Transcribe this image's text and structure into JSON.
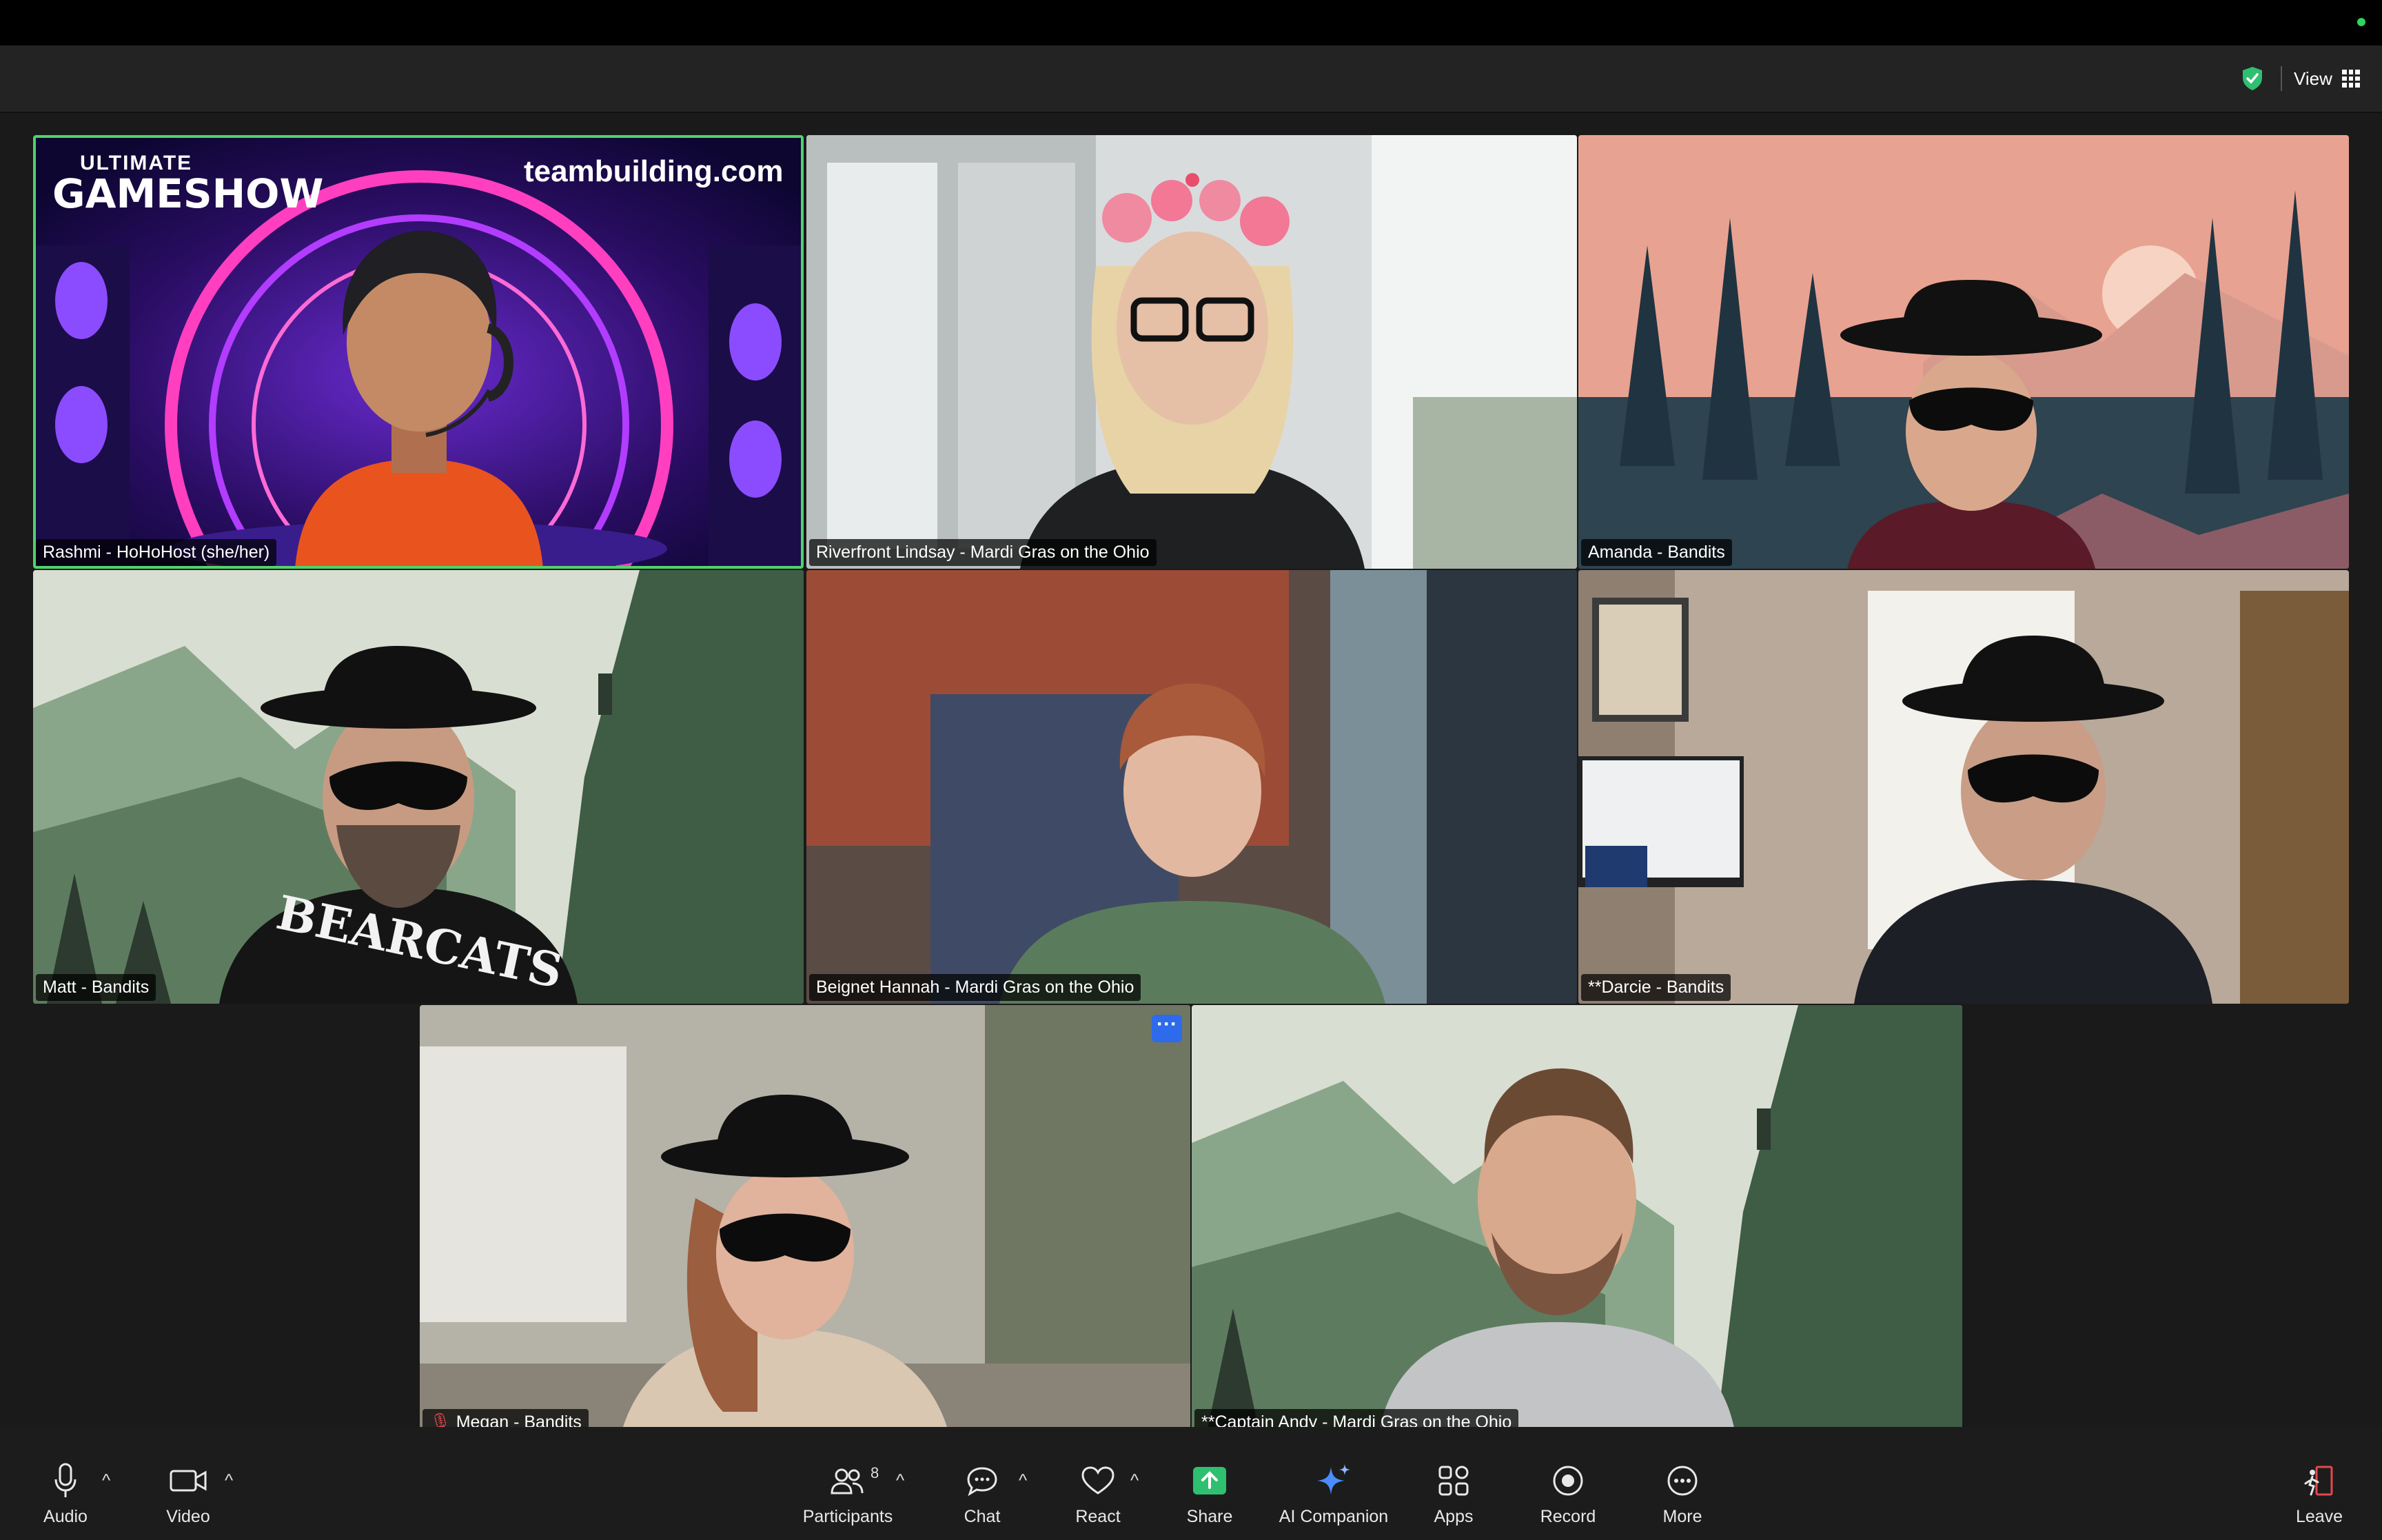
{
  "header": {
    "view_label": "View"
  },
  "participants": [
    {
      "name": "Rashmi - HoHoHost (she/her)",
      "active_speaker": true,
      "background_text": [
        "ULTIMATE",
        "GAMESHOW",
        "teambuilding.com"
      ]
    },
    {
      "name": "Riverfront Lindsay - Mardi Gras on the Ohio"
    },
    {
      "name": "Amanda - Bandits"
    },
    {
      "name": "Matt - Bandits",
      "shirt_text": "BEARCATS"
    },
    {
      "name": "Beignet Hannah - Mardi Gras on the Ohio"
    },
    {
      "name": "**Darcie - Bandits"
    },
    {
      "name": "Megan - Bandits",
      "muted": true
    },
    {
      "name": "**Captain Andy - Mardi Gras on the Ohio"
    }
  ],
  "tile_menu": "···",
  "toolbar": {
    "audio": "Audio",
    "video": "Video",
    "participants": "Participants",
    "participants_count": "8",
    "chat": "Chat",
    "react": "React",
    "share": "Share",
    "ai_companion": "AI Companion",
    "apps": "Apps",
    "record": "Record",
    "more": "More",
    "leave": "Leave"
  },
  "colors": {
    "active_speaker": "#4fd36b",
    "share": "#2fbf71",
    "leave": "#e5484d",
    "badge": "#2d6bec"
  }
}
